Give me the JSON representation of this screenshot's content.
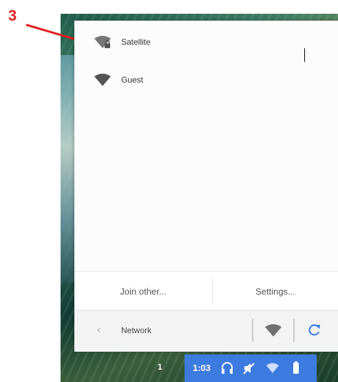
{
  "annotation": {
    "number": "3",
    "color": "#e02020"
  },
  "networks": [
    {
      "name": "Satellite",
      "secured": true,
      "icon": "wifi-lock-icon"
    },
    {
      "name": "Guest",
      "secured": false,
      "icon": "wifi-icon"
    }
  ],
  "footer": {
    "join_other": "Join other...",
    "settings": "Settings..."
  },
  "header": {
    "back_icon": "chevron-left-icon",
    "title": "Network",
    "refresh_icon": "refresh-icon"
  },
  "taskbar": {
    "shelf_number": "1",
    "time": "1:03",
    "icons": [
      "headphones-icon",
      "mute-icon",
      "wifi-icon",
      "battery-icon"
    ],
    "accent": "#3d7be0"
  }
}
